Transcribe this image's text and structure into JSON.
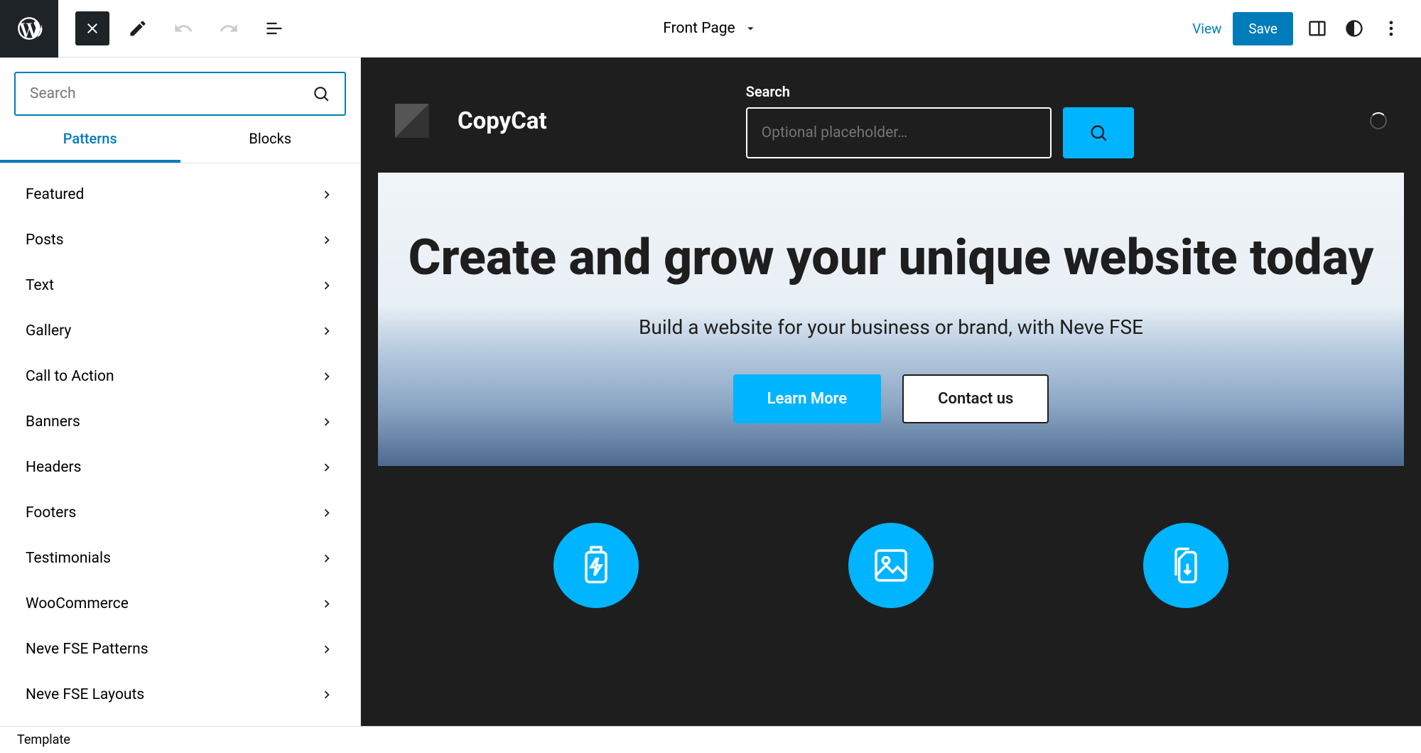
{
  "toolbar": {
    "page_title": "Front Page",
    "view_label": "View",
    "save_label": "Save"
  },
  "sidebar": {
    "search_placeholder": "Search",
    "tabs": [
      {
        "label": "Patterns",
        "active": true
      },
      {
        "label": "Blocks",
        "active": false
      }
    ],
    "categories": [
      {
        "label": "Featured"
      },
      {
        "label": "Posts"
      },
      {
        "label": "Text"
      },
      {
        "label": "Gallery"
      },
      {
        "label": "Call to Action"
      },
      {
        "label": "Banners"
      },
      {
        "label": "Headers"
      },
      {
        "label": "Footers"
      },
      {
        "label": "Testimonials"
      },
      {
        "label": "WooCommerce"
      },
      {
        "label": "Neve FSE Patterns"
      },
      {
        "label": "Neve FSE Layouts"
      }
    ]
  },
  "canvas": {
    "site_title": "CopyCat",
    "search_label": "Search",
    "search_placeholder": "Optional placeholder…",
    "hero_heading": "Create and grow your unique website today",
    "hero_sub": "Build a website for your business or brand, with Neve FSE",
    "btn_primary": "Learn More",
    "btn_secondary": "Contact us"
  },
  "bottom": {
    "label": "Template"
  },
  "colors": {
    "accent": "#00b4ff",
    "wp_blue": "#007cba",
    "dark": "#1e1e1e"
  }
}
